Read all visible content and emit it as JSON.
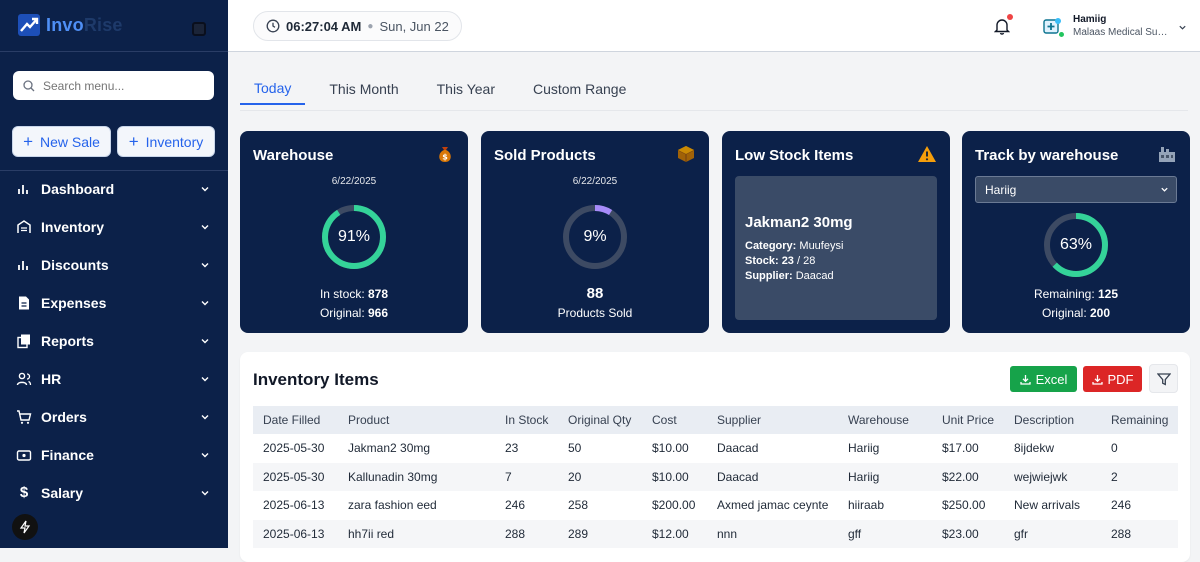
{
  "brand": {
    "part1": "Invo",
    "part2": "Rise"
  },
  "sidebar": {
    "search_placeholder": "Search menu...",
    "new_sale": "New Sale",
    "inventory_btn": "Inventory",
    "items": [
      {
        "label": "Dashboard",
        "icon": "bar-chart-icon"
      },
      {
        "label": "Inventory",
        "icon": "warehouse-icon"
      },
      {
        "label": "Discounts",
        "icon": "bar-chart-icon"
      },
      {
        "label": "Expenses",
        "icon": "document-icon"
      },
      {
        "label": "Reports",
        "icon": "copy-icon"
      },
      {
        "label": "HR",
        "icon": "users-icon"
      },
      {
        "label": "Orders",
        "icon": "cart-icon"
      },
      {
        "label": "Finance",
        "icon": "wallet-icon"
      },
      {
        "label": "Salary",
        "icon": "dollar-icon"
      }
    ]
  },
  "topbar": {
    "time": "06:27:04 AM",
    "date": "Sun, Jun 22",
    "user_name": "Hamiig",
    "user_company": "Malaas Medical Supplies"
  },
  "tabs": [
    "Today",
    "This Month",
    "This Year",
    "Custom Range"
  ],
  "cards": {
    "warehouse": {
      "title": "Warehouse",
      "date": "6/22/2025",
      "percent": 91,
      "percent_label": "91%",
      "in_stock_label": "In stock:",
      "in_stock": "878",
      "original_label": "Original:",
      "original": "966",
      "icon": "money-bag-icon"
    },
    "sold": {
      "title": "Sold Products",
      "date": "6/22/2025",
      "percent": 9,
      "percent_label": "9%",
      "count": "88",
      "count_label": "Products Sold",
      "icon": "package-icon"
    },
    "low_stock": {
      "title": "Low Stock Items",
      "product": "Jakman2 30mg",
      "category_label": "Category:",
      "category": "Muufeysi",
      "stock_label": "Stock:",
      "stock": "23",
      "stock_total": "/ 28",
      "supplier_label": "Supplier:",
      "supplier": "Daacad",
      "icon": "warning-icon"
    },
    "track": {
      "title": "Track by warehouse",
      "selected": "Hariig",
      "percent": 63,
      "percent_label": "63%",
      "remaining_label": "Remaining:",
      "remaining": "125",
      "original_label": "Original:",
      "original": "200",
      "icon": "factory-icon"
    }
  },
  "inventory": {
    "title": "Inventory Items",
    "excel": "Excel",
    "pdf": "PDF",
    "columns": [
      "Date Filled",
      "Product",
      "In Stock",
      "Original Qty",
      "Cost",
      "Supplier",
      "Warehouse",
      "Unit Price",
      "Description",
      "Remaining"
    ],
    "rows": [
      [
        "2025-05-30",
        "Jakman2 30mg",
        "23",
        "50",
        "$10.00",
        "Daacad",
        "Hariig",
        "$17.00",
        "8ijdekw",
        "0"
      ],
      [
        "2025-05-30",
        "Kallunadin 30mg",
        "7",
        "20",
        "$10.00",
        "Daacad",
        "Hariig",
        "$22.00",
        "wejwiejwk",
        "2"
      ],
      [
        "2025-06-13",
        "zara fashion eed",
        "246",
        "258",
        "$200.00",
        "Axmed jamac ceynte",
        "hiiraab",
        "$250.00",
        "New arrivals",
        "246"
      ],
      [
        "2025-06-13",
        "hh7ii red",
        "288",
        "289",
        "$12.00",
        "nnn",
        "gff",
        "$23.00",
        "gfr",
        "288"
      ]
    ]
  },
  "colors": {
    "navy": "#0c2149",
    "ring_green": "#34d399",
    "ring_purple": "#a78bfa",
    "accent": "#2563eb"
  }
}
